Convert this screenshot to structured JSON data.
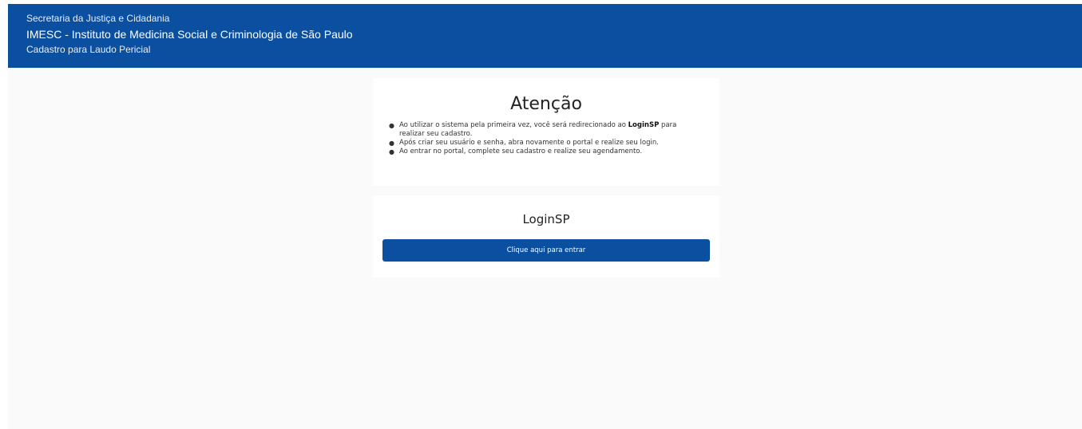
{
  "header": {
    "line1": "Secretaria da Justiça e Cidadania",
    "line2": "IMESC - Instituto de Medicina Social e Criminologia de São Paulo",
    "line3": "Cadastro para Laudo Pericial"
  },
  "attention": {
    "title": "Atenção",
    "items": [
      {
        "before": "Ao utilizar o sistema pela primeira vez, você será redirecionado ao ",
        "bold": "LoginSP",
        "after": " para realizar seu cadastro."
      },
      {
        "text": "Após criar seu usuário e senha, abra novamente o portal e realize seu login."
      },
      {
        "text": "Ao entrar no portal, complete seu cadastro e realize seu agendamento."
      }
    ]
  },
  "login": {
    "title": "LoginSP",
    "button_label": "Clique aqui para entrar"
  },
  "colors": {
    "brand_blue": "#0b4fa1",
    "background": "#fafafa"
  }
}
